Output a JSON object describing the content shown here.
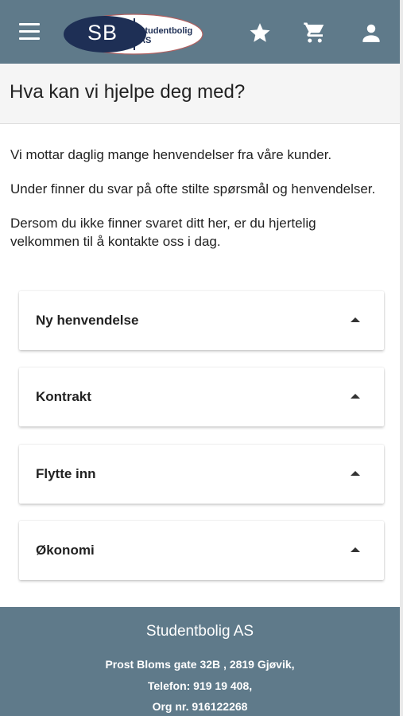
{
  "header": {
    "logo_initials": "SB",
    "logo_line1": "Studentbolig",
    "logo_line2": "AS",
    "icons": [
      "menu-icon",
      "star-icon",
      "cart-icon",
      "user-icon"
    ]
  },
  "page": {
    "title": "Hva kan vi hjelpe deg med?",
    "intro": [
      "Vi mottar daglig mange henvendelser fra våre kunder.",
      "Under finner du svar på ofte stilte spørsmål og henvendelser.",
      "Dersom du ikke finner svaret ditt her, er du hjertelig velkommen til å kontakte oss i dag."
    ]
  },
  "accordion": [
    {
      "label": "Ny henvendelse"
    },
    {
      "label": "Kontrakt"
    },
    {
      "label": "Flytte inn"
    },
    {
      "label": "Økonomi"
    }
  ],
  "footer": {
    "company": "Studentbolig AS",
    "address": "Prost Bloms gate 32B , 2819 Gjøvik,",
    "phone": "Telefon: 919 19 408,",
    "org": "Org nr. 916122268"
  },
  "colors": {
    "bar": "#5f7a8a",
    "logo_navy": "#1e2f55"
  }
}
